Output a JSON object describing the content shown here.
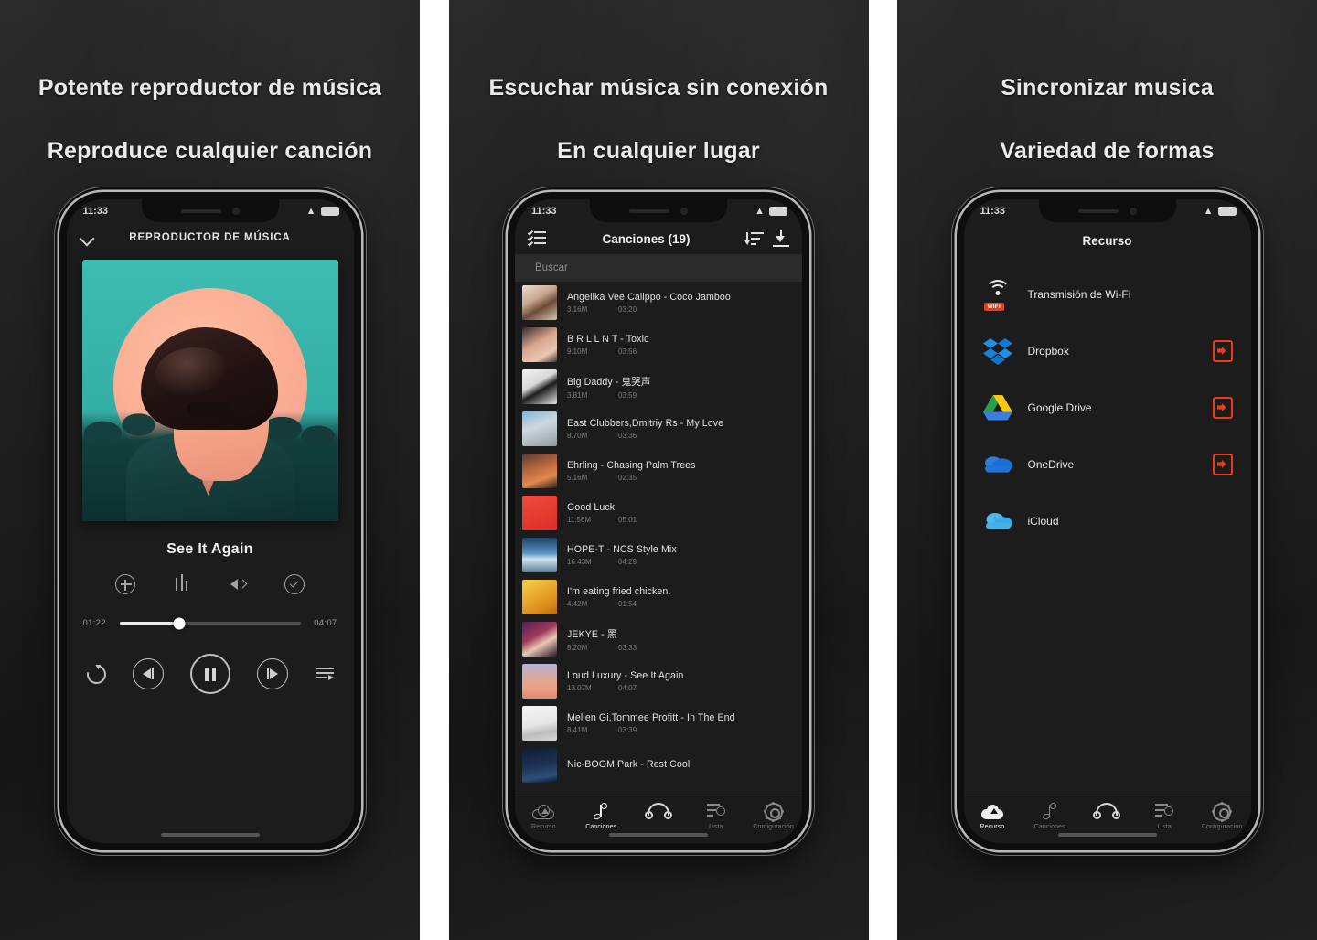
{
  "panels": [
    {
      "headline": "Potente reproductor de música",
      "subline": "Reproduce cualquier canción",
      "status_time": "11:33",
      "player": {
        "screen_title": "REPRODUCTOR DE MÚSICA",
        "now_playing": "See It Again",
        "elapsed": "01:22",
        "duration": "04:07",
        "progress_percent": 33,
        "fx_icons": [
          "add-to-playlist-icon",
          "equalizer-icon",
          "volume-icon",
          "sleep-timer-icon"
        ],
        "transport_icons": [
          "repeat-icon",
          "previous-icon",
          "pause-icon",
          "next-icon",
          "queue-icon"
        ]
      }
    },
    {
      "headline": "Escuchar música sin conexión",
      "subline": "En cualquier lugar",
      "status_time": "11:33",
      "songs_screen": {
        "title": "Canciones (19)",
        "search_placeholder": "Buscar",
        "left_icon": "multi-select-icon",
        "right_icons": [
          "sort-icon",
          "download-icon"
        ],
        "songs": [
          {
            "name": "Angelika Vee,Calippo - Coco Jamboo",
            "size": "3.16M",
            "duration": "03:20",
            "art": "t1"
          },
          {
            "name": "B R L L N T - Toxic",
            "size": "9.10M",
            "duration": "03:56",
            "art": "t2"
          },
          {
            "name": "Big Daddy - 鬼哭声",
            "size": "3.81M",
            "duration": "03:59",
            "art": "t3"
          },
          {
            "name": "East Clubbers,Dmitriy Rs - My Love",
            "size": "8.70M",
            "duration": "03:36",
            "art": "t4"
          },
          {
            "name": "Ehrling - Chasing Palm Trees",
            "size": "5.16M",
            "duration": "02:35",
            "art": "t5"
          },
          {
            "name": "Good Luck",
            "size": "11.56M",
            "duration": "05:01",
            "art": "t6"
          },
          {
            "name": "HOPE-T - NCS Style Mix",
            "size": "16.43M",
            "duration": "04:29",
            "art": "t7"
          },
          {
            "name": "I'm eating fried chicken.",
            "size": "4.42M",
            "duration": "01:54",
            "art": "t8"
          },
          {
            "name": "JEKYE - 黑",
            "size": "8.20M",
            "duration": "03:33",
            "art": "t9"
          },
          {
            "name": "Loud Luxury - See It Again",
            "size": "13.07M",
            "duration": "04:07",
            "art": "t10"
          },
          {
            "name": "Mellen Gi,Tommee Profitt - In The End",
            "size": "8.41M",
            "duration": "03:39",
            "art": "t11"
          },
          {
            "name": "Nic-BOOM,Park - Rest Cool",
            "size": "",
            "duration": "",
            "art": "t12"
          }
        ]
      }
    },
    {
      "headline": "Sincronizar musica",
      "subline": "Variedad de formas",
      "status_time": "11:33",
      "resource_screen": {
        "title": "Recurso",
        "items": [
          {
            "label": "Transmisión de Wi-Fi",
            "icon": "wifi-icon",
            "badge": "WiFi",
            "has_export": false
          },
          {
            "label": "Dropbox",
            "icon": "dropbox-icon",
            "badge": "",
            "has_export": true
          },
          {
            "label": "Google Drive",
            "icon": "google-drive-icon",
            "badge": "",
            "has_export": true
          },
          {
            "label": "OneDrive",
            "icon": "onedrive-icon",
            "badge": "",
            "has_export": true
          },
          {
            "label": "iCloud",
            "icon": "icloud-icon",
            "badge": "",
            "has_export": false
          }
        ]
      }
    }
  ],
  "tabbar": {
    "items": [
      {
        "label": "Recurso",
        "icon": "cloud-upload-icon"
      },
      {
        "label": "Canciones",
        "icon": "music-note-icon"
      },
      {
        "label": "",
        "icon": "headphones-icon"
      },
      {
        "label": "Lista",
        "icon": "playlist-icon"
      },
      {
        "label": "Configuración",
        "icon": "gear-icon"
      }
    ],
    "active_index_phone2": 1,
    "active_index_phone3": 0
  },
  "colors": {
    "accent_red": "#ef3a17",
    "panel_bg": "#1e1e1e",
    "screen_bg": "#1c1c1c",
    "text_primary": "#ececec",
    "text_muted": "#7d7d7d"
  }
}
